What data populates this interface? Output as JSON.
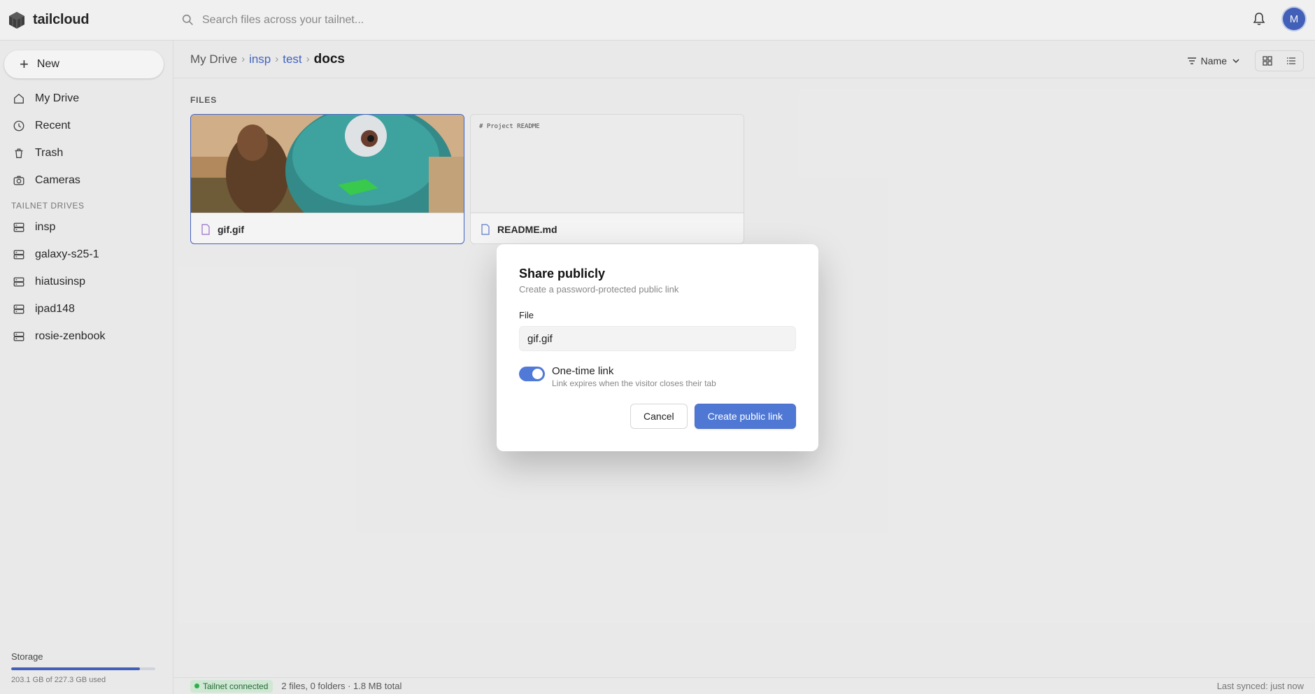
{
  "app": {
    "name": "tailcloud",
    "logo_icon": "cube-logo"
  },
  "search": {
    "placeholder": "Search files across your tailnet..."
  },
  "user": {
    "avatar_initial": "M"
  },
  "sidebar": {
    "new_label": "New",
    "items": [
      {
        "label": "My Drive",
        "icon": "home-icon"
      },
      {
        "label": "Recent",
        "icon": "clock-icon"
      },
      {
        "label": "Trash",
        "icon": "trash-icon"
      },
      {
        "label": "Cameras",
        "icon": "camera-icon"
      }
    ],
    "drives_label": "TAILNET DRIVES",
    "drives": [
      {
        "label": "insp"
      },
      {
        "label": "galaxy-s25-1"
      },
      {
        "label": "hiatusinsp"
      },
      {
        "label": "ipad148"
      },
      {
        "label": "rosie-zenbook"
      }
    ],
    "storage": {
      "label": "Storage",
      "text": "203.1 GB of 227.3 GB used",
      "fraction": 0.894
    }
  },
  "breadcrumb": {
    "root": "My Drive",
    "items": [
      "insp",
      "test"
    ],
    "current": "docs"
  },
  "sort": {
    "label": "Name"
  },
  "files_label": "FILES",
  "files": [
    {
      "name": "gif.gif",
      "selected": true
    },
    {
      "name": "README.md",
      "preview": "# Project README"
    }
  ],
  "status": {
    "connection": "Tailnet connected",
    "summary": "2 files, 0 folders · 1.8 MB total",
    "synced": "Last synced: just now"
  },
  "modal": {
    "title": "Share publicly",
    "subtitle": "Create a password-protected public link",
    "file_label": "File",
    "file_value": "gif.gif",
    "toggle_title": "One-time link",
    "toggle_desc": "Link expires when the visitor closes their tab",
    "toggle_on": true,
    "cancel": "Cancel",
    "confirm": "Create public link"
  },
  "colors": {
    "accent": "#4f78d4",
    "link": "#3f63c7",
    "connected": "#2bb24c"
  }
}
